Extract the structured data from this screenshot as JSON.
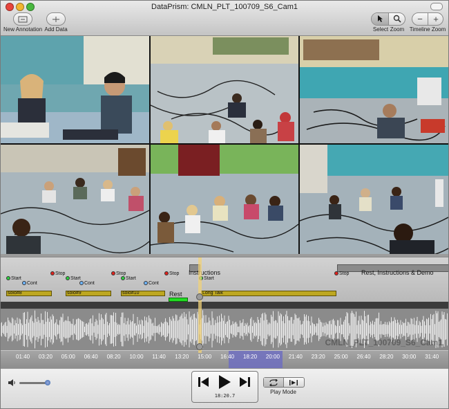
{
  "window": {
    "title": "DataPrism: CMLN_PLT_100709_S6_Cam1"
  },
  "toolbar": {
    "new_annotation_label": "New Annotation",
    "add_data_label": "Add Data",
    "select_label": "Select",
    "zoom_label": "Zoom",
    "timeline_zoom_label": "Timeline Zoom",
    "zoom_out_glyph": "−",
    "zoom_in_glyph": "+"
  },
  "annotations": {
    "instructions_label": "Instructions",
    "rest_instr_label": "Rest, Instructions & Demo",
    "start_label": "Start",
    "stop_label": "Stop",
    "cont_label": "Cont",
    "segments": [
      "solo#8",
      "solo#9",
      "solo#10"
    ],
    "rest_label": "Rest",
    "long_talk_label": "Long Talk",
    "colors": {
      "start": "#2ecc40",
      "stop": "#e0231e",
      "cont": "#6fb6ff",
      "segment": "#bda720",
      "rest": "#22dd22"
    }
  },
  "waveform": {
    "watermark": "CMLN_PLT_100709_S6_Cam1"
  },
  "ruler": {
    "ticks": [
      "01:40",
      "03:20",
      "05:00",
      "06:40",
      "08:20",
      "10:00",
      "11:40",
      "13:20",
      "15:00",
      "16:40",
      "18:20",
      "20:00",
      "21:40",
      "23:20",
      "25:00",
      "26:40",
      "28:20",
      "30:00",
      "31:40"
    ]
  },
  "playback": {
    "time": "18:20.7",
    "play_mode_label": "Play Mode"
  }
}
